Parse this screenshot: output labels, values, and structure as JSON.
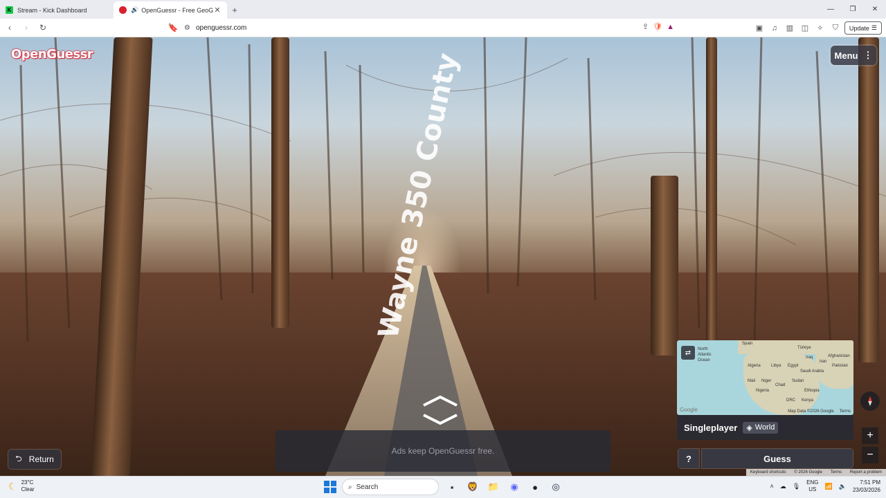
{
  "browser": {
    "tabs": [
      {
        "title": "Stream - Kick Dashboard",
        "active": false
      },
      {
        "title": "OpenGuessr - Free GeoGuess",
        "active": true
      }
    ],
    "url": "openguessr.com",
    "update_label": "Update"
  },
  "game": {
    "logo": "OpenGuessr",
    "menu_label": "Menu",
    "road_label": "Wayne 350 County",
    "return_label": "Return",
    "ads_text": "Ads keep OpenGuessr free.",
    "mode_label": "Singleplayer",
    "map_label": "World",
    "help_label": "?",
    "guess_label": "Guess",
    "minimap": {
      "labels": [
        "North",
        "Atlantic",
        "Ocean",
        "Spain",
        "Türkiye",
        "Iraq",
        "Afghanistan",
        "Iran",
        "Algeria",
        "Libya",
        "Egypt",
        "Saudi Arabia",
        "Pakistan",
        "Mali",
        "Niger",
        "Chad",
        "Sudan",
        "Nigeria",
        "Ethiopia",
        "DRC",
        "Kenya"
      ],
      "attribution": "Map Data ©2026 Google",
      "terms": "Terms",
      "google": "Google"
    },
    "footer": {
      "shortcuts": "Keyboard shortcuts",
      "data": "© 2026 Google",
      "terms": "Terms",
      "report": "Report a problem"
    }
  },
  "taskbar": {
    "temp": "23°C",
    "condition": "Clear",
    "search_placeholder": "Search",
    "lang1": "ENG",
    "lang2": "US",
    "time": "7:51 PM",
    "date": "23/03/2026"
  }
}
